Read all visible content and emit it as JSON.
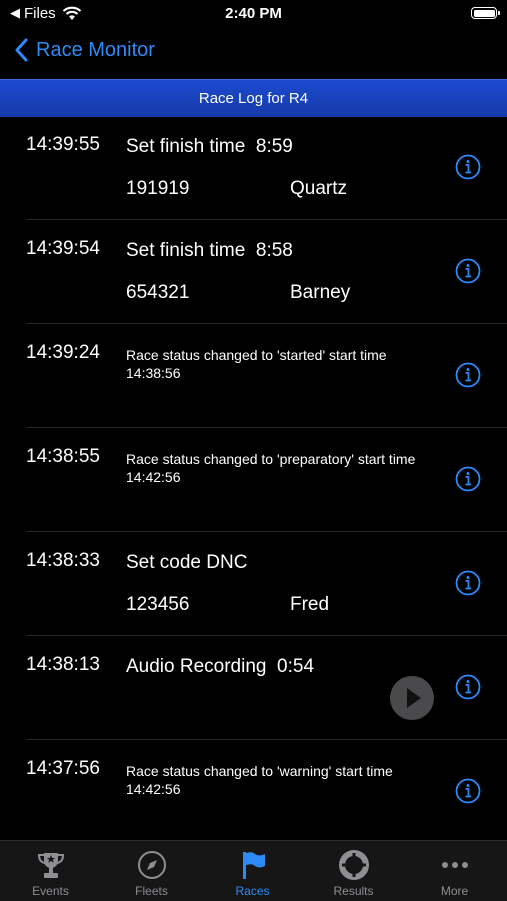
{
  "status_bar": {
    "back_app": "Files",
    "time": "2:40 PM"
  },
  "nav": {
    "back_label": "Race Monitor"
  },
  "title": "Race Log for R4",
  "log": [
    {
      "time": "14:39:55",
      "action": "Set finish time",
      "value": "8:59",
      "id": "191919",
      "name": "Quartz"
    },
    {
      "time": "14:39:54",
      "action": "Set finish time",
      "value": "8:58",
      "id": "654321",
      "name": "Barney"
    },
    {
      "time": "14:39:24",
      "message": "Race status changed to 'started' start time 14:38:56"
    },
    {
      "time": "14:38:55",
      "message": "Race status changed to 'preparatory' start time 14:42:56"
    },
    {
      "time": "14:38:33",
      "action": "Set code",
      "value": "DNC",
      "id": "123456",
      "name": "Fred"
    },
    {
      "time": "14:38:13",
      "action": "Audio Recording",
      "value": "0:54"
    },
    {
      "time": "14:37:56",
      "message": "Race status changed to 'warning' start time 14:42:56"
    }
  ],
  "tabs": [
    {
      "label": "Events",
      "icon": "trophy-icon"
    },
    {
      "label": "Fleets",
      "icon": "compass-icon"
    },
    {
      "label": "Races",
      "icon": "flag-icon",
      "active": true
    },
    {
      "label": "Results",
      "icon": "lifebuoy-icon"
    },
    {
      "label": "More",
      "icon": "more-dots-icon"
    }
  ],
  "colors": {
    "accent": "#2e8bf5",
    "title_strip": "#1c4bd0",
    "background": "#000000",
    "tab_bar": "#161617"
  }
}
